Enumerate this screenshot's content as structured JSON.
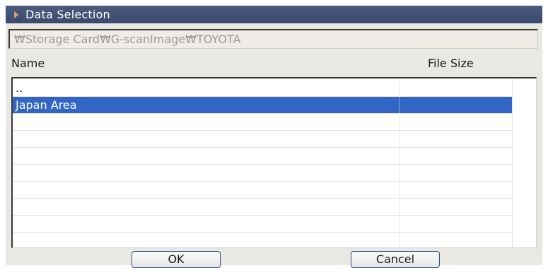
{
  "window": {
    "title": "Data Selection"
  },
  "path": {
    "value": "₩Storage Card₩G-scanImage₩TOYOTA"
  },
  "columns": {
    "name": "Name",
    "size": "File Size"
  },
  "rows": [
    {
      "name": "..",
      "size": "",
      "selected": false
    },
    {
      "name": "Japan Area",
      "size": "",
      "selected": true
    }
  ],
  "buttons": {
    "ok": "OK",
    "cancel": "Cancel"
  },
  "colors": {
    "titlebar": "#3d4e70",
    "selection": "#3166c5",
    "background": "#e9e8e3"
  }
}
